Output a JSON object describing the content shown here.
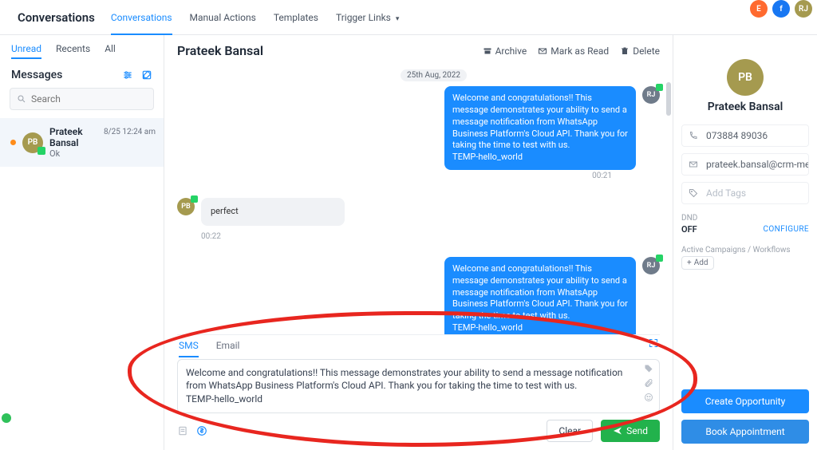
{
  "top_circles": {
    "a": "E",
    "b": "f",
    "c": "RJ"
  },
  "header": {
    "title": "Conversations",
    "tabs": [
      {
        "label": "Conversations",
        "active": true
      },
      {
        "label": "Manual Actions"
      },
      {
        "label": "Templates"
      },
      {
        "label": "Trigger Links"
      }
    ]
  },
  "left": {
    "filters": [
      {
        "label": "Unread",
        "active": true
      },
      {
        "label": "Recents"
      },
      {
        "label": "All"
      }
    ],
    "messages_label": "Messages",
    "search_placeholder": "Search",
    "conversation": {
      "initials": "PB",
      "name": "Prateek Bansal",
      "snippet": "Ok",
      "time": "8/25 12:24 am"
    }
  },
  "center": {
    "title": "Prateek Bansal",
    "actions": {
      "archive": "Archive",
      "mark_read": "Mark as Read",
      "delete": "Delete"
    },
    "date_chip": "25th Aug, 2022",
    "msg1": "Welcome and congratulations!! This message demonstrates your ability to send a message notification from WhatsApp Business Platform's Cloud API. Thank you for taking the time to test with us.\nTEMP-hello_world",
    "msg1_ts": "00:21",
    "msg2": "perfect",
    "msg2_ts": "00:22",
    "msg3": "Welcome and congratulations!! This message demonstrates your ability to send a message notification from WhatsApp Business Platform's Cloud API. Thank you for taking the time to test with us.\nTEMP-hello_world",
    "avatar_left": "PB",
    "avatar_right": "RJ",
    "compose_tabs": {
      "sms": "SMS",
      "email": "Email"
    },
    "compose_text": "Welcome and congratulations!! This message demonstrates your ability to send a message notification from WhatsApp Business Platform's Cloud API. Thank you for taking the time to test with us.\nTEMP-hello_world",
    "clear": "Clear",
    "send": "Send"
  },
  "right": {
    "initials": "PB",
    "name": "Prateek Bansal",
    "phone": "073884 89036",
    "email": "prateek.bansal@crm-messagi",
    "tags_placeholder": "Add Tags",
    "dnd_label": "DND",
    "dnd_value": "OFF",
    "dnd_configure": "CONFIGURE",
    "campaigns_label": "Active Campaigns / Workflows",
    "add_label": "Add",
    "create_opportunity": "Create Opportunity",
    "book_appointment": "Book Appointment"
  }
}
